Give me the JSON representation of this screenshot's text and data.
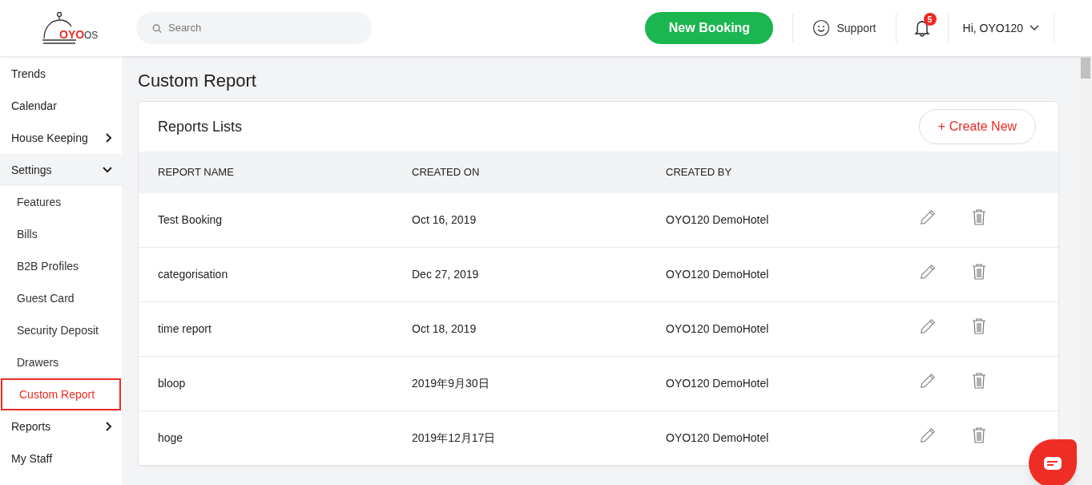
{
  "header": {
    "logo": {
      "brand": "OYO",
      "suffix": "OS"
    },
    "search": {
      "placeholder": "Search"
    },
    "new_booking": "New Booking",
    "support": "Support",
    "notifications": {
      "count": "5"
    },
    "user": "Hi, OYO120"
  },
  "sidebar": {
    "items": [
      {
        "label": "Trends",
        "kind": "link"
      },
      {
        "label": "Calendar",
        "kind": "link"
      },
      {
        "label": "House Keeping",
        "kind": "group",
        "expanded": false
      },
      {
        "label": "Settings",
        "kind": "group",
        "expanded": true,
        "children": [
          {
            "label": "Features",
            "selected": false
          },
          {
            "label": "Bills",
            "selected": false
          },
          {
            "label": "B2B Profiles",
            "selected": false
          },
          {
            "label": "Guest Card",
            "selected": false
          },
          {
            "label": "Security Deposit",
            "selected": false
          },
          {
            "label": "Drawers",
            "selected": false
          },
          {
            "label": "Custom Report",
            "selected": true
          }
        ]
      },
      {
        "label": "Reports",
        "kind": "group",
        "expanded": false
      },
      {
        "label": "My Staff",
        "kind": "link"
      }
    ]
  },
  "page": {
    "title": "Custom Report",
    "card": {
      "title": "Reports Lists",
      "create_button": "+ Create New",
      "table": {
        "columns": [
          "REPORT NAME",
          "CREATED ON",
          "CREATED BY"
        ],
        "rows": [
          {
            "name": "Test Booking",
            "created_on": "Oct 16, 2019",
            "created_by": "OYO120 DemoHotel"
          },
          {
            "name": "categorisation",
            "created_on": "Dec 27, 2019",
            "created_by": "OYO120 DemoHotel"
          },
          {
            "name": "time report",
            "created_on": "Oct 18, 2019",
            "created_by": "OYO120 DemoHotel"
          },
          {
            "name": "bloop",
            "created_on": "2019年9月30日",
            "created_by": "OYO120 DemoHotel"
          },
          {
            "name": "hoge",
            "created_on": "2019年12月17日",
            "created_by": "OYO120 DemoHotel"
          }
        ]
      }
    }
  }
}
